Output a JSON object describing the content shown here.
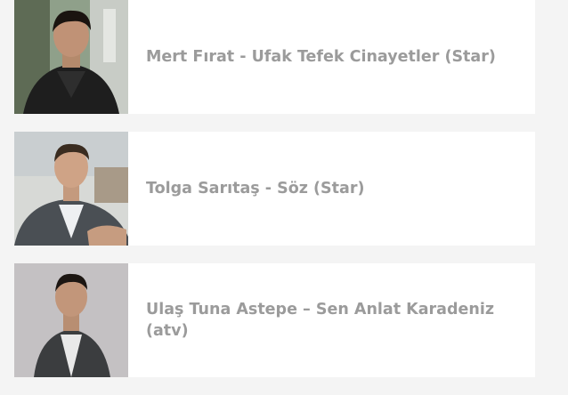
{
  "articles": [
    {
      "title": "Mert Fırat - Ufak Tefek Cinayetler (Star)"
    },
    {
      "title": "Tolga Sarıtaş - Söz (Star)"
    },
    {
      "title": "Ulaş Tuna Astepe – Sen Anlat Karadeniz (atv)"
    }
  ]
}
